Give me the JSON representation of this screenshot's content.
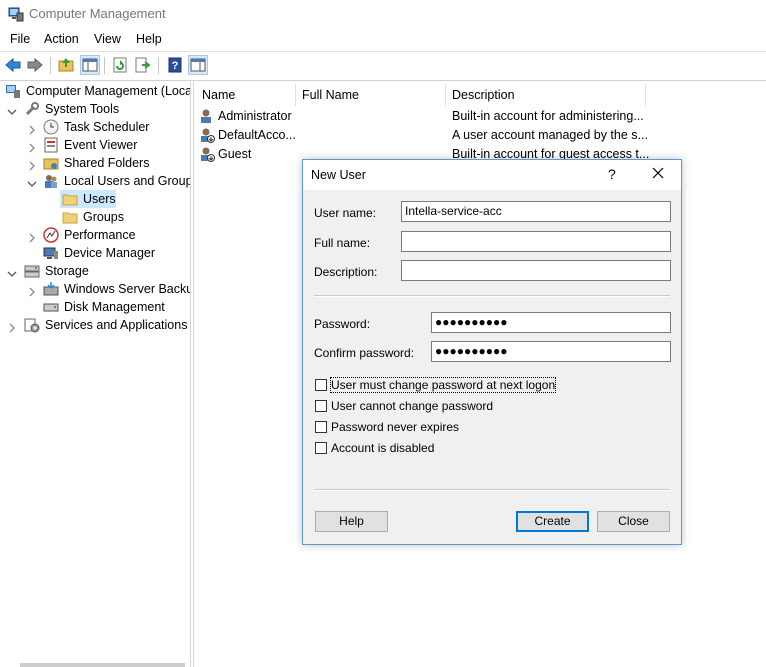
{
  "window": {
    "title": "Computer Management"
  },
  "menu": [
    "File",
    "Action",
    "View",
    "Help"
  ],
  "toolbar_icons": [
    "back-arrow-icon",
    "forward-arrow-icon",
    "up-folder-icon",
    "show-hide-tree-icon",
    "refresh-icon",
    "export-list-icon",
    "help-icon",
    "show-hide-action-pane-icon"
  ],
  "tree": {
    "root": "Computer Management (Local",
    "system_tools": "System Tools",
    "task_scheduler": "Task Scheduler",
    "event_viewer": "Event Viewer",
    "shared_folders": "Shared Folders",
    "local_users_groups": "Local Users and Groups",
    "users": "Users",
    "groups": "Groups",
    "performance": "Performance",
    "device_manager": "Device Manager",
    "storage": "Storage",
    "wsb": "Windows Server Backup",
    "disk_mgmt": "Disk Management",
    "services_apps": "Services and Applications"
  },
  "list": {
    "columns": [
      "Name",
      "Full Name",
      "Description"
    ],
    "rows": [
      {
        "name": "Administrator",
        "full_name": "",
        "description": "Built-in account for administering..."
      },
      {
        "name": "DefaultAcco...",
        "full_name": "",
        "description": "A user account managed by the s..."
      },
      {
        "name": "Guest",
        "full_name": "",
        "description": "Built-in account for guest access t..."
      }
    ]
  },
  "dialog": {
    "title": "New User",
    "help_glyph": "?",
    "user_name_label": "User name:",
    "user_name_value": "Intella-service-acc",
    "full_name_label": "Full name:",
    "full_name_value": "",
    "description_label": "Description:",
    "description_value": "",
    "password_label": "Password:",
    "password_value": "●●●●●●●●●●",
    "confirm_label": "Confirm password:",
    "confirm_value": "●●●●●●●●●●",
    "chk_must_change": "User must change password at next logon",
    "chk_cannot_change": "User cannot change password",
    "chk_never_expires": "Password never expires",
    "chk_disabled": "Account is disabled",
    "help_button": "Help",
    "create_button": "Create",
    "close_button": "Close"
  }
}
